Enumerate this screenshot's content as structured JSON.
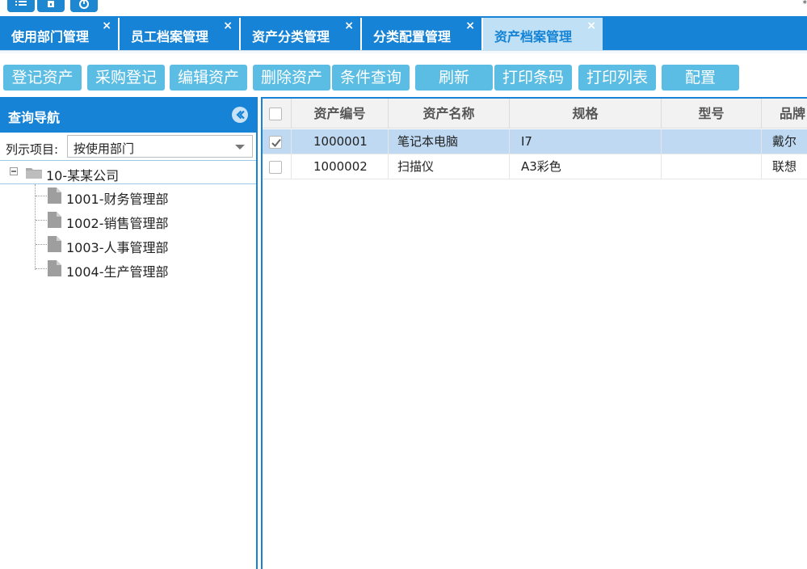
{
  "colors": {
    "primary": "#1683d6",
    "active_tab_bg": "#bfe0f5",
    "toolbar_button": "#5bbde3",
    "selected_row": "#bed9f1"
  },
  "topbar": {
    "icons": [
      "list-icon",
      "lock-icon",
      "power-icon"
    ],
    "corner_mark": "*"
  },
  "tabs": [
    {
      "label": "使用部门管理",
      "close": "×",
      "active": false
    },
    {
      "label": "员工档案管理",
      "close": "×",
      "active": false
    },
    {
      "label": "资产分类管理",
      "close": "×",
      "active": false
    },
    {
      "label": "分类配置管理",
      "close": "×",
      "active": false
    },
    {
      "label": "资产档案管理",
      "close": "×",
      "active": true
    }
  ],
  "toolbar": {
    "buttons": [
      "登记资产",
      "采购登记",
      "编辑资产",
      "删除资产",
      "条件查询",
      "刷新",
      "打印条码",
      "打印列表",
      "配置"
    ]
  },
  "nav": {
    "title": "查询导航",
    "collapse_icon": "chevron-left-circle-icon",
    "filter_label": "列示项目:",
    "filter_value": "按使用部门",
    "tree": {
      "root_label": "10-某某公司",
      "root_icon": "folder-icon",
      "children": [
        "1001-财务管理部",
        "1002-销售管理部",
        "1003-人事管理部",
        "1004-生产管理部"
      ],
      "child_icon": "file-icon"
    }
  },
  "grid": {
    "columns": [
      "资产编号",
      "资产名称",
      "规格",
      "型号",
      "品牌"
    ],
    "rows": [
      {
        "checked": true,
        "selected": true,
        "cells": [
          "1000001",
          "笔记本电脑",
          "I7",
          "",
          "戴尔"
        ]
      },
      {
        "checked": false,
        "selected": false,
        "cells": [
          "1000002",
          "扫描仪",
          "A3彩色",
          "",
          "联想"
        ]
      }
    ]
  }
}
